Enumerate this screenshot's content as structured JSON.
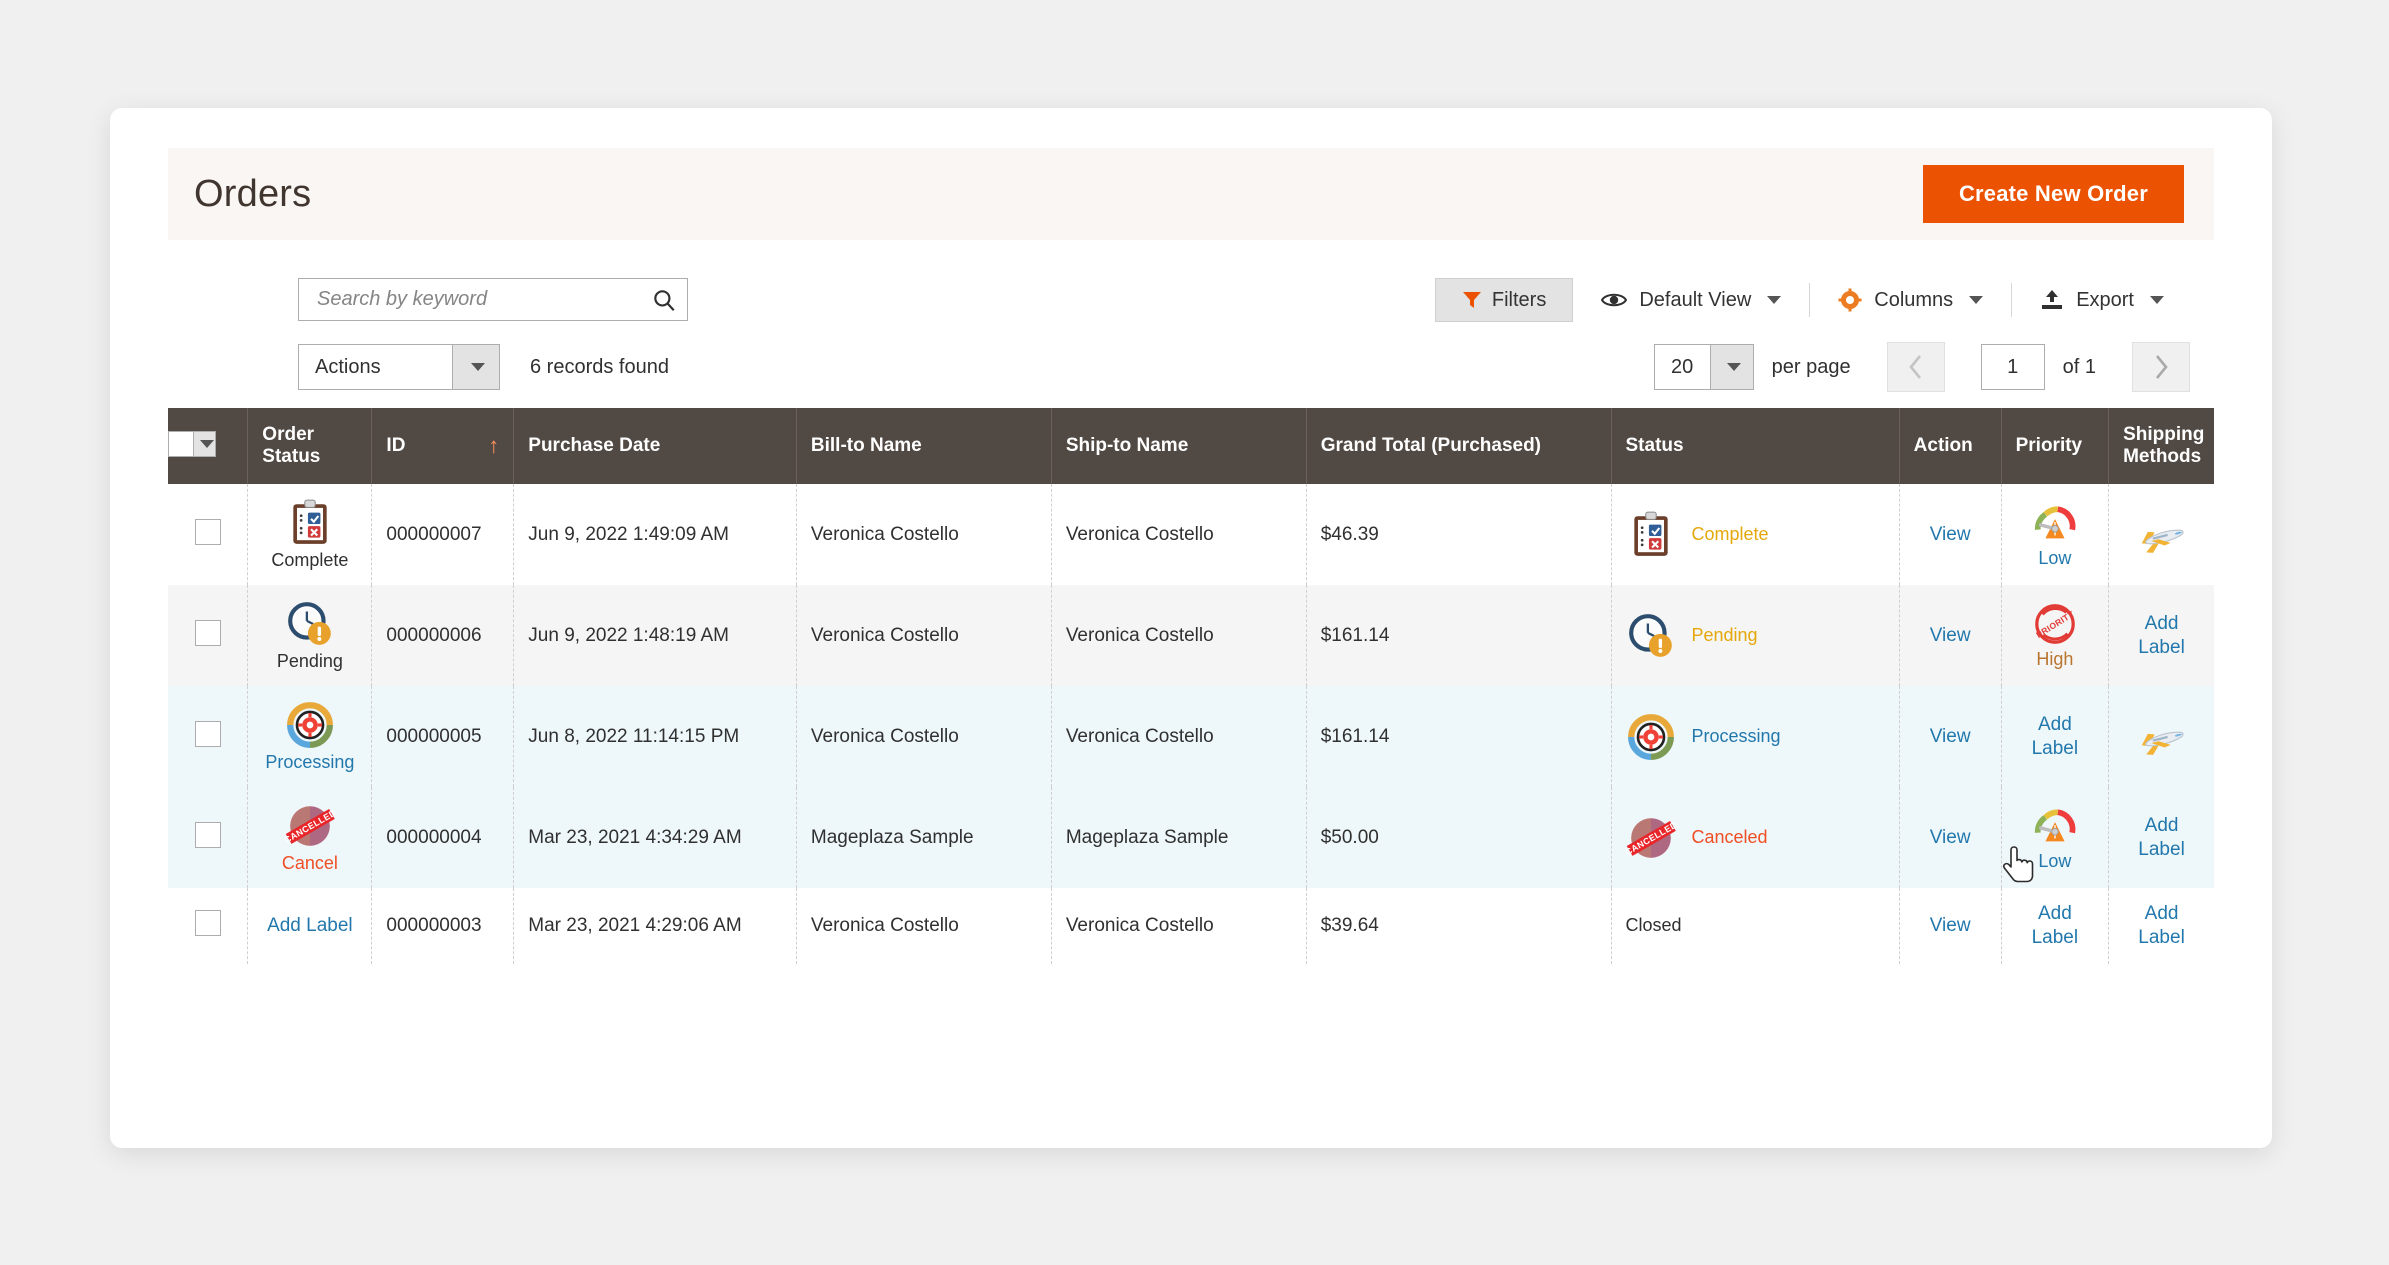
{
  "header": {
    "title": "Orders",
    "create_button": "Create New Order"
  },
  "search": {
    "placeholder": "Search by keyword",
    "value": "",
    "icon": "search-icon"
  },
  "toolbar": {
    "filters": "Filters",
    "default_view": "Default View",
    "columns": "Columns",
    "export": "Export"
  },
  "controls": {
    "actions_label": "Actions",
    "records_found": "6 records found",
    "per_page_value": "20",
    "per_page_label": "per page",
    "page_value": "1",
    "page_of": "of 1",
    "prev_icon": "chevron-left-icon",
    "next_icon": "chevron-right-icon"
  },
  "table": {
    "columns": [
      {
        "key": "checkbox",
        "label": ""
      },
      {
        "key": "order_status",
        "label": "Order Status"
      },
      {
        "key": "id",
        "label": "ID",
        "sorted": "asc",
        "sort_glyph": "↑"
      },
      {
        "key": "purchase_date",
        "label": "Purchase Date"
      },
      {
        "key": "bill_to",
        "label": "Bill-to Name"
      },
      {
        "key": "ship_to",
        "label": "Ship-to Name"
      },
      {
        "key": "grand_total",
        "label": "Grand Total (Purchased)"
      },
      {
        "key": "status",
        "label": "Status"
      },
      {
        "key": "action",
        "label": "Action"
      },
      {
        "key": "priority",
        "label": "Priority"
      },
      {
        "key": "shipping_methods",
        "label": "Shipping Methods"
      }
    ],
    "rows": [
      {
        "row_style": "r-white",
        "order_status_label": "Complete",
        "order_status_icon": "clipboard-checklist-icon",
        "id": "000000007",
        "purchase_date": "Jun 9, 2022 1:49:09 AM",
        "bill_to": "Veronica Costello",
        "ship_to": "Veronica Costello",
        "grand_total": "$46.39",
        "status_label": "Complete",
        "status_icon": "clipboard-checklist-icon",
        "status_class": "sl-complete",
        "action": "View",
        "priority_label": "Low",
        "priority_icon": "gauge-low-icon",
        "priority_class": "pl-low",
        "shipping_label": "",
        "shipping_icon": "airplane-icon"
      },
      {
        "row_style": "r-gray",
        "order_status_label": "Pending",
        "order_status_icon": "clock-alert-icon",
        "id": "000000006",
        "purchase_date": "Jun 9, 2022 1:48:19 AM",
        "bill_to": "Veronica Costello",
        "ship_to": "Veronica Costello",
        "grand_total": "$161.14",
        "status_label": "Pending",
        "status_icon": "clock-alert-icon",
        "status_class": "sl-pending",
        "action": "View",
        "priority_label": "High",
        "priority_icon": "priority-stamp-icon",
        "priority_class": "pl-high",
        "shipping_label": "Add Label",
        "shipping_icon": ""
      },
      {
        "row_style": "r-blue",
        "order_status_label": "Processing",
        "order_status_icon": "gear-cycle-icon",
        "id": "000000005",
        "purchase_date": "Jun 8, 2022 11:14:15 PM",
        "bill_to": "Veronica Costello",
        "ship_to": "Veronica Costello",
        "grand_total": "$161.14",
        "status_label": "Processing",
        "status_icon": "gear-cycle-icon",
        "status_class": "sl-processing",
        "action": "View",
        "priority_label": "Add Label",
        "priority_icon": "",
        "priority_class": "",
        "shipping_label": "",
        "shipping_icon": "airplane-icon"
      },
      {
        "row_style": "r-blue",
        "order_status_label": "Cancel",
        "order_status_icon": "cancelled-stamp-icon",
        "id": "000000004",
        "purchase_date": "Mar 23, 2021 4:34:29 AM",
        "bill_to": "Mageplaza Sample",
        "ship_to": "Mageplaza Sample",
        "grand_total": "$50.00",
        "status_label": "Canceled",
        "status_icon": "cancelled-stamp-icon",
        "status_class": "sl-canceled",
        "action": "View",
        "priority_label": "Low",
        "priority_icon": "gauge-low-icon",
        "priority_class": "pl-low",
        "shipping_label": "Add Label",
        "shipping_icon": ""
      },
      {
        "row_style": "r-white",
        "order_status_label": "Add Label",
        "order_status_icon": "",
        "id": "000000003",
        "purchase_date": "Mar 23, 2021 4:29:06 AM",
        "bill_to": "Veronica Costello",
        "ship_to": "Veronica Costello",
        "grand_total": "$39.64",
        "status_label": "Closed",
        "status_icon": "",
        "status_class": "sl-closed",
        "action": "View",
        "priority_label": "Add Label",
        "priority_icon": "",
        "priority_class": "",
        "shipping_label": "Add Label",
        "shipping_icon": ""
      }
    ]
  },
  "colors": {
    "accent_orange": "#eb5202",
    "header_bar": "#514943",
    "link_blue": "#2278ad",
    "header_band": "#faf6f3"
  }
}
